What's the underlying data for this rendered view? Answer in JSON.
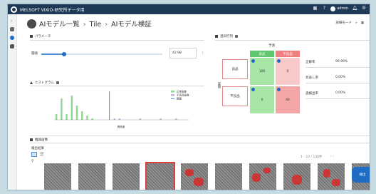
{
  "app": {
    "title": "MELSOFT VIXIO-研究所データ用",
    "user": "admin"
  },
  "header": {
    "breadcrumb": [
      "AIモデル一覧",
      "Tile",
      "AIモデル検証"
    ],
    "action_label": "詳細モード"
  },
  "parameter": {
    "title": "パラメータ",
    "threshold_label": "閾値",
    "threshold_value": "42.98"
  },
  "histogram": {
    "title": "ヒストグラム",
    "legend": [
      "正常画像",
      "不良品画像",
      "閾値"
    ],
    "xlabel": "異常度"
  },
  "chart_data": {
    "type": "bar",
    "title": "ヒストグラム",
    "xlabel": "異常度",
    "ylabel": "",
    "series": [
      {
        "name": "正常画像",
        "color": "#8fd88f",
        "values": [
          0.2,
          0.75,
          0.2,
          0.85,
          0.5,
          0.3,
          0.15,
          0.05,
          0,
          0,
          0,
          0,
          0,
          0,
          0,
          0,
          0,
          0,
          0,
          0,
          0,
          0,
          0,
          0,
          0
        ]
      },
      {
        "name": "不良品画像",
        "color": "#c8b4d8",
        "values": [
          0,
          0,
          0,
          0,
          0,
          0,
          0,
          0,
          0,
          0,
          0,
          0.05,
          0.05,
          0,
          0,
          0,
          0.05,
          0,
          0,
          0,
          0.05,
          0,
          0,
          0.05,
          0
        ]
      }
    ],
    "threshold": {
      "name": "閾値",
      "bin": 10.5,
      "color": "#4a90d9"
    },
    "ylim": [
      0,
      1
    ],
    "grid": false,
    "legend_position": "top-right"
  },
  "confusion": {
    "title": "混同行列",
    "predicted_label": "予測",
    "col_headers": [
      "良品",
      "不良品"
    ],
    "actual_label": "実際",
    "row_headers": [
      "良品",
      "不良品"
    ],
    "cells": [
      [
        "100",
        "0"
      ],
      [
        "0",
        "40"
      ]
    ],
    "metrics": [
      {
        "label": "正解率",
        "value": "99.99%"
      },
      {
        "label": "見逃し率",
        "value": "0.00%"
      },
      {
        "label": "過検出率",
        "value": "0.00%"
      }
    ]
  },
  "results": {
    "section_title": "推論画像",
    "subsection_title": "検出結果",
    "pager": "1 - 10 / 140件",
    "fab_label": "検出",
    "thumbnails": [
      {
        "defect": false,
        "selected": false
      },
      {
        "defect": false,
        "selected": false
      },
      {
        "defect": false,
        "selected": false
      },
      {
        "defect": false,
        "selected": true
      },
      {
        "defect": true,
        "selected": false
      },
      {
        "defect": false,
        "selected": false
      },
      {
        "defect": true,
        "selected": false
      },
      {
        "defect": true,
        "selected": false
      },
      {
        "defect": true,
        "selected": false
      },
      {
        "defect": false,
        "selected": false
      }
    ]
  },
  "colors": {
    "titlebar": "#1f3a56",
    "accent": "#1e6cc4",
    "tp": "#a8e6a8",
    "fn": "#f4a6a6"
  }
}
